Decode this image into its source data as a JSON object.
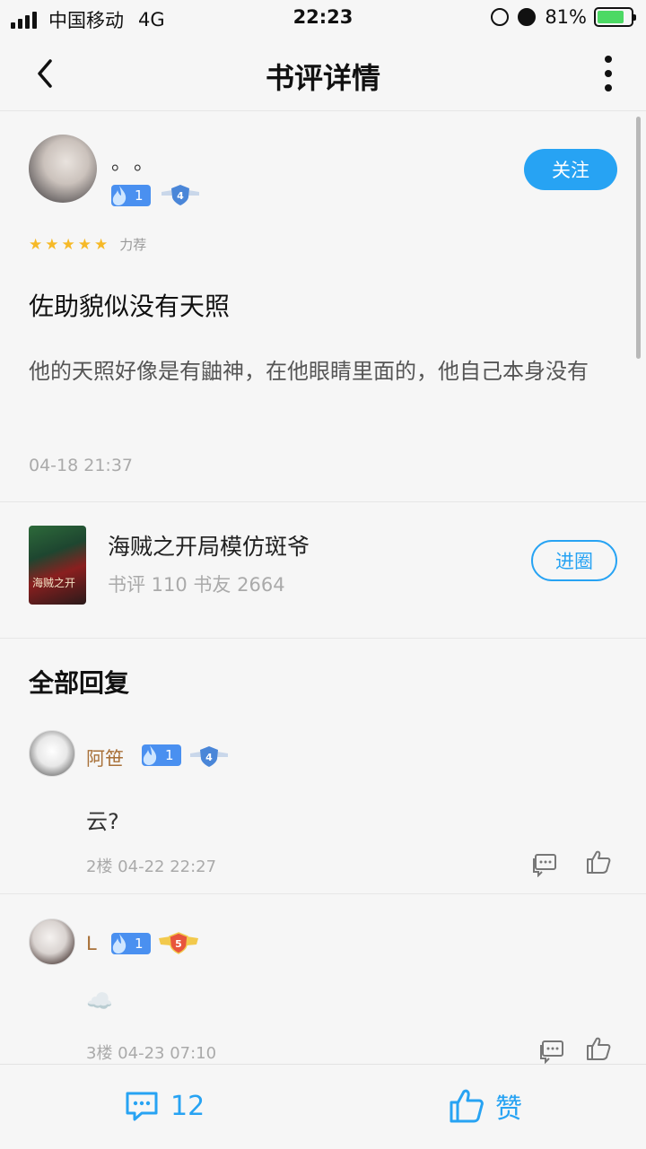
{
  "status_bar": {
    "carrier": "中国移动",
    "network": "4G",
    "time": "22:23",
    "battery": "81%"
  },
  "header": {
    "title": "书评详情"
  },
  "review": {
    "author_name": "。。",
    "level": "1",
    "badge_level": "4",
    "follow_label": "关注",
    "rating_stars": 5,
    "rating_label": "力荐",
    "title": "佐助貌似没有天照",
    "body": "他的天照好像是有鼬神，在他眼睛里面的，他自己本身没有",
    "time": "04-18 21:37"
  },
  "book": {
    "title": "海贼之开局模仿斑爷",
    "stats": "书评 110  书友 2664",
    "join_label": "进圈",
    "cover_text": "海贼之开"
  },
  "replies": {
    "heading": "全部回复",
    "items": [
      {
        "name": "阿笹",
        "level": "1",
        "badge_level": "4",
        "text": "云?",
        "floor_time": "2楼  04-22 22:27"
      },
      {
        "name": "L",
        "level": "1",
        "badge_level": "5",
        "text": "☁️",
        "floor_time": "3楼  04-23 07:10"
      }
    ]
  },
  "bottom_bar": {
    "comment_count": "12",
    "like_label": "赞"
  },
  "colors": {
    "accent": "#27a3f3",
    "star": "#f6b927",
    "username": "#a87038"
  }
}
